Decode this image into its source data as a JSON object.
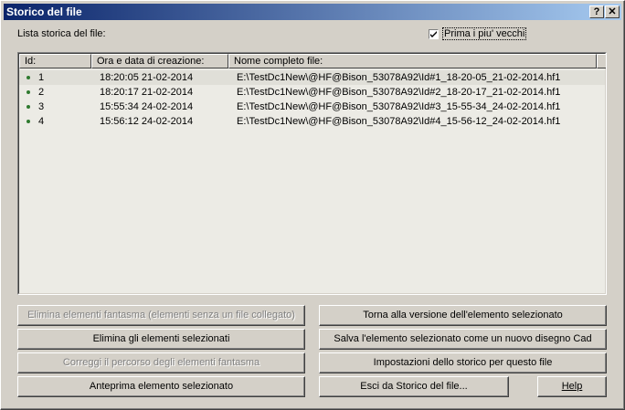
{
  "window": {
    "title": "Storico del file"
  },
  "title_buttons": {
    "help": "?",
    "close": "✕"
  },
  "list_label": "Lista storica del file:",
  "checkbox": {
    "label": "Prima i piu' vecchi",
    "checked": true
  },
  "columns": [
    "Id:",
    "Ora e data di creazione:",
    "Nome completo file:"
  ],
  "rows": [
    {
      "id": "1",
      "datetime": "18:20:05 21-02-2014",
      "file": "E:\\TestDc1New\\@HF@Bison_53078A92\\Id#1_18-20-05_21-02-2014.hf1"
    },
    {
      "id": "2",
      "datetime": "18:20:17 21-02-2014",
      "file": "E:\\TestDc1New\\@HF@Bison_53078A92\\Id#2_18-20-17_21-02-2014.hf1"
    },
    {
      "id": "3",
      "datetime": "15:55:34 24-02-2014",
      "file": "E:\\TestDc1New\\@HF@Bison_53078A92\\Id#3_15-55-34_24-02-2014.hf1"
    },
    {
      "id": "4",
      "datetime": "15:56:12 24-02-2014",
      "file": "E:\\TestDc1New\\@HF@Bison_53078A92\\Id#4_15-56-12_24-02-2014.hf1"
    }
  ],
  "buttons": {
    "delete_ghosts": "Elimina elementi fantasma (elementi senza un file collegato)",
    "delete_selected": "Elimina gli elementi selezionati",
    "fix_ghost_path": "Correggi il percorso degli elementi fantasma",
    "preview": "Anteprima elemento selezionato",
    "revert": "Torna alla versione dell'elemento selezionato",
    "save_as_new": "Salva l'elemento selezionato come un nuovo disegno Cad",
    "settings": "Impostazioni dello storico per questo file",
    "exit": "Esci da Storico del file...",
    "help": "Help"
  }
}
